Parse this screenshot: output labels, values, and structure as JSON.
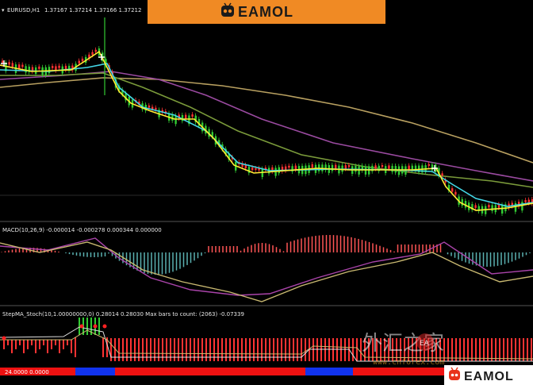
{
  "window": {
    "symbol_label": "EURUSD,H1",
    "ohlc": "1.37167 1.37214 1.37166 1.37212"
  },
  "banner": {
    "brand": "EAMOL"
  },
  "macd_panel": {
    "label": "MACD(10,26,9) -0.000014 -0.000278 0.000344 0.000000"
  },
  "stoch_panel": {
    "label": "StepMA_Stoch(10,1.00000000,0) 0.28014 0.28030 Max bars to count: (2063) -0.07339"
  },
  "bottom_strip": {
    "label": "24.0000 0.0000"
  },
  "watermark": {
    "chinese": "外汇之家",
    "stamp": "EA",
    "url": "www.cnforex.com"
  },
  "corner_logo": {
    "brand": "EAMOL"
  },
  "colors": {
    "background": "#000000",
    "candle_up": "#33cc33",
    "candle_down": "#ff3333",
    "ma_fast": "#ffee33",
    "ma_cyan": "#44d8e8",
    "ma_olive": "#7a9a3a",
    "ma_purple": "#9a4aa0",
    "ma_tan": "#b8a060",
    "macd_hist_up": "#ff5555",
    "macd_hist_down": "#5ab0b0",
    "macd_signal": "#aa44aa",
    "macd_line": "#c8b870",
    "banner_bg": "#f08a24",
    "strip_red": "#ee1111",
    "strip_blue": "#1133ee"
  }
}
